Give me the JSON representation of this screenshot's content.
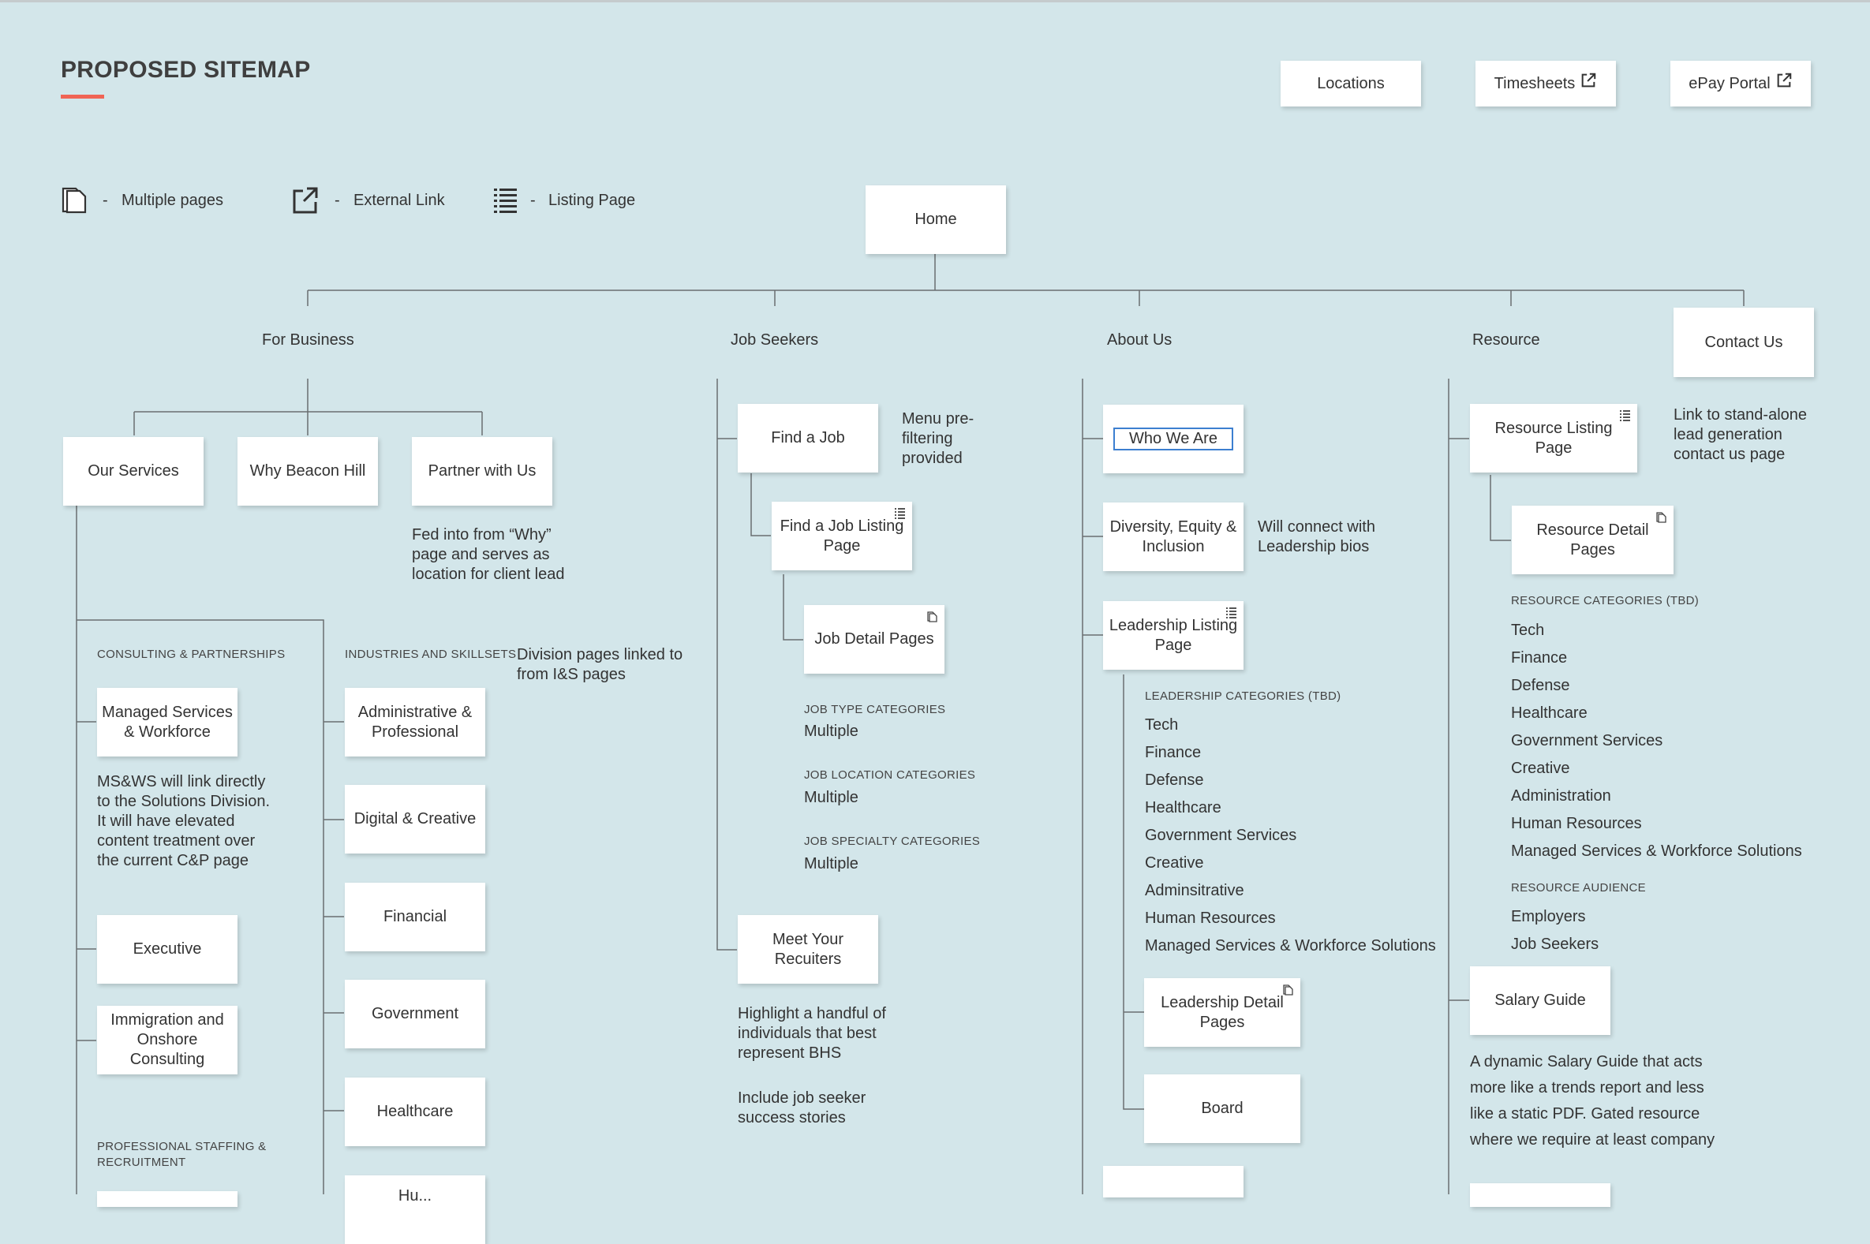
{
  "title": "PROPOSED SITEMAP",
  "top_buttons": {
    "locations": "Locations",
    "timesheets": "Timesheets",
    "epay": "ePay Portal"
  },
  "legend": {
    "dash": "-",
    "multiple": "Multiple pages",
    "external": "External Link",
    "listing": "Listing Page"
  },
  "home": "Home",
  "sections": {
    "business": "For Business",
    "jobs": "Job Seekers",
    "about": "About Us",
    "resource": "Resource",
    "contact": "Contact Us"
  },
  "business": {
    "our_services": "Our Services",
    "why": "Why Beacon Hill",
    "partner": "Partner with Us",
    "partner_note": "Fed into from “Why” page and serves as location for client lead",
    "consulting_cat": "CONSULTING & PARTNERSHIPS",
    "managed": "Managed Services & Workforce",
    "managed_note": "MS&WS will link directly to the Solutions Division. It will have elevated content treatment over the current C&P page",
    "executive": "Executive",
    "immigration": "Immigration and Onshore Consulting",
    "staffing_cat": "PROFESSIONAL STAFFING & RECRUITMENT",
    "industries_cat": "INDUSTRIES AND SKILLSETS",
    "industries_note": "Division pages linked to from I&S pages",
    "industries": [
      "Administrative & Professional",
      "Digital & Creative",
      "Financial",
      "Government",
      "Healthcare",
      "Hu..."
    ]
  },
  "jobs": {
    "find": "Find a Job",
    "find_note": "Menu pre-filtering provided",
    "listing": "Find a Job Listing Page",
    "detail": "Job Detail Pages",
    "type_cat": "JOB TYPE CATEGORIES",
    "type_val": "Multiple",
    "location_cat": "JOB LOCATION CATEGORIES",
    "location_val": "Multiple",
    "specialty_cat": "JOB SPECIALTY CATEGORIES",
    "specialty_val": "Multiple",
    "recruiters": "Meet Your Recuiters",
    "recruiters_note": "Highlight a handful of individuals that best represent BHS",
    "stories_note": "Include job seeker success stories"
  },
  "about": {
    "who": "Who We Are",
    "dei": "Diversity, Equity & Inclusion",
    "dei_note": "Will connect with Leadership bios",
    "leadership": "Leadership Listing Page",
    "leadership_cat": "LEADERSHIP CATEGORIES (TBD)",
    "leadership_items": [
      "Tech",
      "Finance",
      "Defense",
      "Healthcare",
      "Government Services",
      "Creative",
      "Adminsitrative",
      "Human Resources",
      "Managed Services & Workforce Solutions"
    ],
    "leadership_detail": "Leadership Detail Pages",
    "board": "Board"
  },
  "resource": {
    "listing": "Resource Listing Page",
    "detail": "Resource Detail Pages",
    "contact_note": "Link to stand-alone lead generation contact us page",
    "categories_cat": "RESOURCE CATEGORIES (TBD)",
    "categories": [
      "Tech",
      "Finance",
      "Defense",
      "Healthcare",
      "Government Services",
      "Creative",
      "Administration",
      "Human Resources",
      "Managed Services & Workforce Solutions"
    ],
    "audience_cat": "RESOURCE AUDIENCE",
    "audience": [
      "Employers",
      "Job Seekers"
    ],
    "salary": "Salary Guide",
    "salary_note": "A dynamic Salary Guide that acts more like a trends report and less like a static PDF. Gated resource where we require at least company"
  },
  "icons": {
    "multiple": "multiple-pages-icon",
    "external": "external-link-icon",
    "listing": "listing-page-icon"
  },
  "colors": {
    "background": "#d3e6ea",
    "accent": "#f06455",
    "line": "#6a6f71"
  }
}
